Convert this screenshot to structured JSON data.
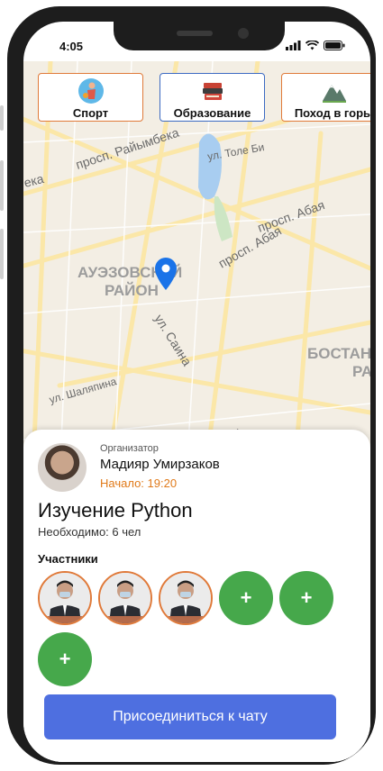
{
  "status": {
    "time": "4:05"
  },
  "categories": [
    {
      "label": "Спорт",
      "icon": "sport-icon"
    },
    {
      "label": "Образование",
      "icon": "books-icon"
    },
    {
      "label": "Поход в горы",
      "icon": "mountain-icon"
    }
  ],
  "map": {
    "labels": {
      "pr1": "просп. Райымбека",
      "pr2": "просп. Абая",
      "tole": "ул. Толе Би",
      "abay2": "просп. Абая",
      "district1a": "АУЭЗОВСКИЙ",
      "district1b": "РАЙОН",
      "saina": "ул. Саина",
      "shalyapin": "ул. Шаляпина",
      "district2a": "БОСТАН",
      "district2b": "РАЙ",
      "left1": "ека",
      "ul": "ул"
    },
    "pin_color": "#1a73e8"
  },
  "event": {
    "organizer_label": "Организатор",
    "organizer_name": "Мадияр Умирзаков",
    "start": "Начало: 19:20",
    "title": "Изучение Python",
    "needed": "Необходимо: 6 чел",
    "participants_label": "Участники",
    "plus_label": "+",
    "join_button": "Присоединиться к чату"
  },
  "colors": {
    "accent_orange": "#e07a3a",
    "green": "#46a84b",
    "blue_button": "#4e6fe0"
  }
}
